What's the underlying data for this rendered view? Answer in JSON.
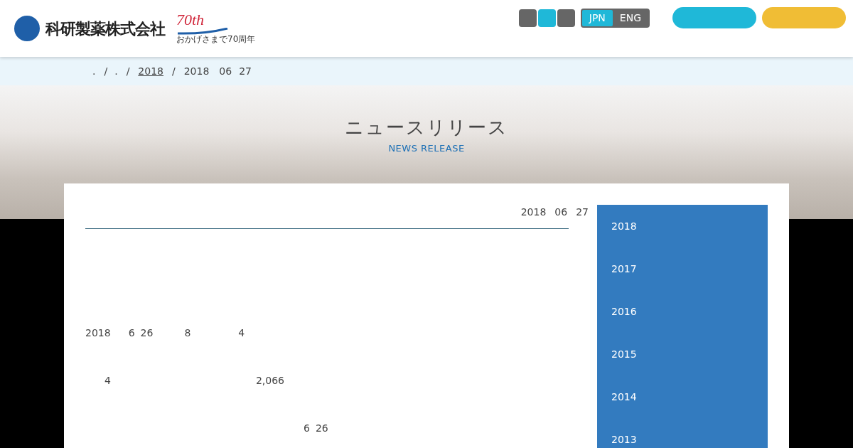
{
  "header": {
    "company_name": "科研製薬株式会社",
    "anniversary_logo": {
      "number": "70th",
      "caption": "おかげさまで70周年"
    },
    "size_buttons": [
      {
        "selected": false
      },
      {
        "selected": true
      },
      {
        "selected": false
      }
    ],
    "language_toggle": [
      {
        "label": "JPN",
        "selected": true
      },
      {
        "label": "ENG",
        "selected": false
      }
    ],
    "pill_buttons": [
      {
        "color": "#1fb8d8"
      },
      {
        "color": "#f0bd35"
      }
    ]
  },
  "breadcrumb": [
    {
      "text": ".",
      "kind": "plain"
    },
    {
      "text": "/",
      "kind": "separator"
    },
    {
      "text": ".",
      "kind": "plain"
    },
    {
      "text": "/",
      "kind": "separator"
    },
    {
      "text": "2018",
      "kind": "link"
    },
    {
      "text": "/",
      "kind": "separator"
    },
    {
      "text": "2018",
      "kind": "plain"
    },
    {
      "text": "06",
      "kind": "plain"
    },
    {
      "text": "27",
      "kind": "plain"
    }
  ],
  "hero": {
    "title": "ニュースリリース",
    "subtitle": "NEWS RELEASE"
  },
  "article": {
    "date": [
      "2018",
      "06",
      "27"
    ],
    "lines": [
      [
        "2018",
        "6",
        "26",
        "8",
        "4"
      ],
      [
        "4",
        "2,066"
      ],
      [
        "6",
        "26"
      ]
    ]
  },
  "sidebar": {
    "years": [
      {
        "label": "2018"
      },
      {
        "label": "2017"
      },
      {
        "label": "2016"
      },
      {
        "label": "2015"
      },
      {
        "label": "2014"
      },
      {
        "label": "2013"
      }
    ]
  }
}
